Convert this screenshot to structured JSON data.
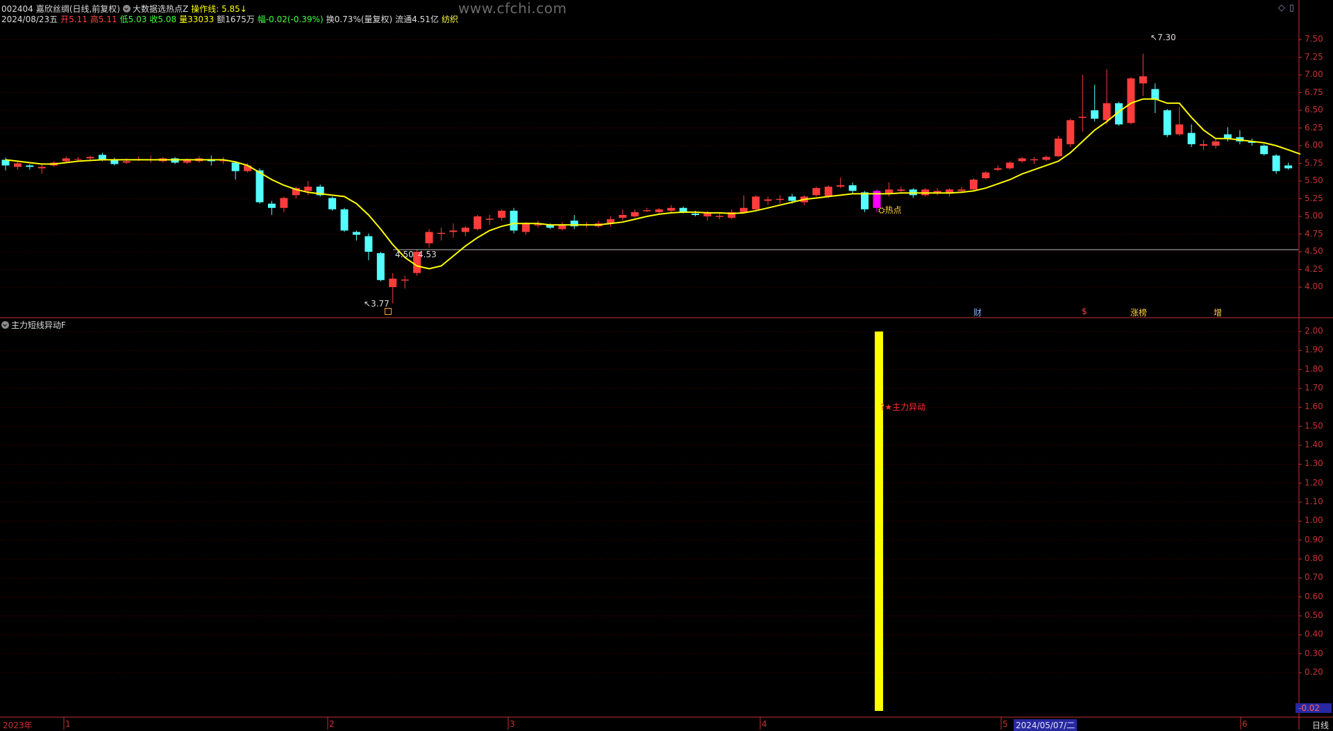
{
  "header": {
    "code": "002404",
    "name": "嘉欣丝绸(日线,前复权)",
    "indicator": "大数据选热点Z",
    "op_line": "操作线: 5.85↓",
    "date": "2024/08/23五",
    "open": "开5.11",
    "high": "高5.11",
    "low": "低5.03",
    "close": "收5.08",
    "volume": "量33033",
    "amount": "额1675万",
    "change": "幅-0.02(-0.39%)",
    "turnover": "换0.73%(量复权)",
    "float_cap": "流通4.51亿",
    "industry": "纺织"
  },
  "watermark": "www.cfchi.com",
  "top_icons": [
    "◇",
    "▯"
  ],
  "upper": {
    "y_labels": [
      "7.50",
      "7.25",
      "7.00",
      "6.75",
      "6.50",
      "6.25",
      "6.00",
      "5.75",
      "5.50",
      "5.25",
      "5.00",
      "4.75",
      "4.50",
      "4.25",
      "4.00"
    ],
    "annotations": {
      "high_mark": "7.30",
      "low_mark": "3.77",
      "h_line_left": "4.50",
      "h_line_right": "4.53",
      "hot_label": "热点"
    },
    "events": [
      "财",
      "$",
      "涨榜",
      "增"
    ]
  },
  "lower": {
    "title": "主力短线异动F",
    "y_labels": [
      "2.00",
      "1.90",
      "1.80",
      "1.70",
      "1.60",
      "1.50",
      "1.40",
      "1.30",
      "1.20",
      "1.10",
      "1.00",
      "0.90",
      "0.80",
      "0.70",
      "0.60",
      "0.50",
      "0.40",
      "0.30",
      "0.20"
    ],
    "signal_label": "★主力异动",
    "current_value": "-0.02"
  },
  "bottom": {
    "year_label": "2023年",
    "month_labels": [
      "1",
      "2",
      "3",
      "4",
      "5",
      "6"
    ],
    "cursor_date": "2024/05/07/二",
    "period": "日线"
  },
  "colors": {
    "up": "#ff3c3c",
    "down": "#54ffff",
    "ma": "#ffff00",
    "grid": "#5a0000",
    "axis": "#c83232",
    "signal": "#ffff00",
    "highlight": "#ff00ff"
  },
  "chart_data": {
    "type": "candlestick",
    "ylim": [
      3.8,
      7.55
    ],
    "candles": [
      {
        "o": 5.8,
        "c": 5.72,
        "h": 5.83,
        "l": 5.65
      },
      {
        "o": 5.7,
        "c": 5.75,
        "h": 5.78,
        "l": 5.66
      },
      {
        "o": 5.72,
        "c": 5.7,
        "h": 5.74,
        "l": 5.66
      },
      {
        "o": 5.68,
        "c": 5.7,
        "h": 5.74,
        "l": 5.6
      },
      {
        "o": 5.72,
        "c": 5.76,
        "h": 5.78,
        "l": 5.7
      },
      {
        "o": 5.78,
        "c": 5.82,
        "h": 5.85,
        "l": 5.76
      },
      {
        "o": 5.8,
        "c": 5.81,
        "h": 5.84,
        "l": 5.77
      },
      {
        "o": 5.82,
        "c": 5.84,
        "h": 5.86,
        "l": 5.8
      },
      {
        "o": 5.87,
        "c": 5.8,
        "h": 5.9,
        "l": 5.78
      },
      {
        "o": 5.8,
        "c": 5.74,
        "h": 5.83,
        "l": 5.72
      },
      {
        "o": 5.76,
        "c": 5.78,
        "h": 5.82,
        "l": 5.74
      },
      {
        "o": 5.8,
        "c": 5.81,
        "h": 5.85,
        "l": 5.78
      },
      {
        "o": 5.8,
        "c": 5.8,
        "h": 5.86,
        "l": 5.76
      },
      {
        "o": 5.78,
        "c": 5.82,
        "h": 5.84,
        "l": 5.76
      },
      {
        "o": 5.82,
        "c": 5.76,
        "h": 5.84,
        "l": 5.74
      },
      {
        "o": 5.76,
        "c": 5.8,
        "h": 5.82,
        "l": 5.74
      },
      {
        "o": 5.78,
        "c": 5.82,
        "h": 5.85,
        "l": 5.76
      },
      {
        "o": 5.8,
        "c": 5.78,
        "h": 5.86,
        "l": 5.72
      },
      {
        "o": 5.78,
        "c": 5.79,
        "h": 5.84,
        "l": 5.74
      },
      {
        "o": 5.76,
        "c": 5.64,
        "h": 5.78,
        "l": 5.52
      },
      {
        "o": 5.64,
        "c": 5.72,
        "h": 5.75,
        "l": 5.62
      },
      {
        "o": 5.65,
        "c": 5.2,
        "h": 5.68,
        "l": 5.18
      },
      {
        "o": 5.18,
        "c": 5.12,
        "h": 5.22,
        "l": 5.02
      },
      {
        "o": 5.12,
        "c": 5.26,
        "h": 5.28,
        "l": 5.06
      },
      {
        "o": 5.3,
        "c": 5.4,
        "h": 5.42,
        "l": 5.25
      },
      {
        "o": 5.36,
        "c": 5.42,
        "h": 5.5,
        "l": 5.3
      },
      {
        "o": 5.42,
        "c": 5.3,
        "h": 5.45,
        "l": 5.28
      },
      {
        "o": 5.26,
        "c": 5.1,
        "h": 5.28,
        "l": 5.08
      },
      {
        "o": 5.1,
        "c": 4.8,
        "h": 5.12,
        "l": 4.78
      },
      {
        "o": 4.78,
        "c": 4.74,
        "h": 4.8,
        "l": 4.66
      },
      {
        "o": 4.72,
        "c": 4.5,
        "h": 4.76,
        "l": 4.38
      },
      {
        "o": 4.48,
        "c": 4.1,
        "h": 4.5,
        "l": 4.08
      },
      {
        "o": 4.0,
        "c": 4.12,
        "h": 4.2,
        "l": 3.77
      },
      {
        "o": 4.1,
        "c": 4.1,
        "h": 4.16,
        "l": 3.98
      },
      {
        "o": 4.2,
        "c": 4.5,
        "h": 4.53,
        "l": 4.16
      },
      {
        "o": 4.62,
        "c": 4.78,
        "h": 4.82,
        "l": 4.56
      },
      {
        "o": 4.76,
        "c": 4.76,
        "h": 4.84,
        "l": 4.66
      },
      {
        "o": 4.78,
        "c": 4.8,
        "h": 4.9,
        "l": 4.7
      },
      {
        "o": 4.78,
        "c": 4.84,
        "h": 4.86,
        "l": 4.72
      },
      {
        "o": 4.82,
        "c": 5.0,
        "h": 5.02,
        "l": 4.8
      },
      {
        "o": 4.96,
        "c": 4.96,
        "h": 5.02,
        "l": 4.88
      },
      {
        "o": 4.98,
        "c": 5.08,
        "h": 5.1,
        "l": 4.94
      },
      {
        "o": 5.08,
        "c": 4.8,
        "h": 5.12,
        "l": 4.76
      },
      {
        "o": 4.78,
        "c": 4.9,
        "h": 4.92,
        "l": 4.74
      },
      {
        "o": 4.88,
        "c": 4.88,
        "h": 4.94,
        "l": 4.84
      },
      {
        "o": 4.88,
        "c": 4.84,
        "h": 4.9,
        "l": 4.82
      },
      {
        "o": 4.82,
        "c": 4.88,
        "h": 4.92,
        "l": 4.8
      },
      {
        "o": 4.94,
        "c": 4.86,
        "h": 5.02,
        "l": 4.82
      },
      {
        "o": 4.88,
        "c": 4.88,
        "h": 4.92,
        "l": 4.84
      },
      {
        "o": 4.86,
        "c": 4.9,
        "h": 4.94,
        "l": 4.84
      },
      {
        "o": 4.9,
        "c": 4.96,
        "h": 5.0,
        "l": 4.86
      },
      {
        "o": 4.98,
        "c": 5.02,
        "h": 5.1,
        "l": 4.94
      },
      {
        "o": 5.0,
        "c": 5.06,
        "h": 5.1,
        "l": 4.98
      },
      {
        "o": 5.08,
        "c": 5.08,
        "h": 5.12,
        "l": 5.06
      },
      {
        "o": 5.06,
        "c": 5.1,
        "h": 5.12,
        "l": 5.04
      },
      {
        "o": 5.08,
        "c": 5.12,
        "h": 5.16,
        "l": 5.06
      },
      {
        "o": 5.12,
        "c": 5.06,
        "h": 5.14,
        "l": 5.04
      },
      {
        "o": 5.04,
        "c": 5.02,
        "h": 5.08,
        "l": 5.0
      },
      {
        "o": 5.0,
        "c": 5.06,
        "h": 5.08,
        "l": 4.94
      },
      {
        "o": 5.0,
        "c": 5.0,
        "h": 5.04,
        "l": 4.96
      },
      {
        "o": 4.98,
        "c": 5.06,
        "h": 5.1,
        "l": 4.96
      },
      {
        "o": 5.06,
        "c": 5.12,
        "h": 5.3,
        "l": 5.04
      },
      {
        "o": 5.1,
        "c": 5.28,
        "h": 5.3,
        "l": 5.08
      },
      {
        "o": 5.22,
        "c": 5.24,
        "h": 5.28,
        "l": 5.16
      },
      {
        "o": 5.24,
        "c": 5.24,
        "h": 5.3,
        "l": 5.18
      },
      {
        "o": 5.28,
        "c": 5.22,
        "h": 5.32,
        "l": 5.18
      },
      {
        "o": 5.2,
        "c": 5.28,
        "h": 5.3,
        "l": 5.16
      },
      {
        "o": 5.3,
        "c": 5.4,
        "h": 5.42,
        "l": 5.28
      },
      {
        "o": 5.28,
        "c": 5.42,
        "h": 5.44,
        "l": 5.26
      },
      {
        "o": 5.42,
        "c": 5.44,
        "h": 5.55,
        "l": 5.4
      },
      {
        "o": 5.44,
        "c": 5.36,
        "h": 5.48,
        "l": 5.32
      },
      {
        "o": 5.34,
        "c": 5.1,
        "h": 5.36,
        "l": 5.06
      },
      {
        "o": 5.12,
        "c": 5.36,
        "h": 5.38,
        "l": 5.06,
        "hl": true
      },
      {
        "o": 5.32,
        "c": 5.38,
        "h": 5.48,
        "l": 5.28
      },
      {
        "o": 5.36,
        "c": 5.38,
        "h": 5.42,
        "l": 5.32
      },
      {
        "o": 5.38,
        "c": 5.3,
        "h": 5.4,
        "l": 5.26
      },
      {
        "o": 5.3,
        "c": 5.38,
        "h": 5.4,
        "l": 5.28
      },
      {
        "o": 5.34,
        "c": 5.36,
        "h": 5.4,
        "l": 5.3
      },
      {
        "o": 5.32,
        "c": 5.38,
        "h": 5.4,
        "l": 5.28
      },
      {
        "o": 5.36,
        "c": 5.38,
        "h": 5.42,
        "l": 5.34
      },
      {
        "o": 5.38,
        "c": 5.52,
        "h": 5.54,
        "l": 5.36
      },
      {
        "o": 5.54,
        "c": 5.62,
        "h": 5.64,
        "l": 5.52
      },
      {
        "o": 5.66,
        "c": 5.68,
        "h": 5.72,
        "l": 5.64
      },
      {
        "o": 5.68,
        "c": 5.76,
        "h": 5.78,
        "l": 5.66
      },
      {
        "o": 5.78,
        "c": 5.82,
        "h": 5.84,
        "l": 5.76
      },
      {
        "o": 5.8,
        "c": 5.8,
        "h": 5.84,
        "l": 5.74
      },
      {
        "o": 5.8,
        "c": 5.84,
        "h": 5.86,
        "l": 5.78
      },
      {
        "o": 5.85,
        "c": 6.1,
        "h": 6.14,
        "l": 5.84
      },
      {
        "o": 6.02,
        "c": 6.36,
        "h": 6.38,
        "l": 5.98
      },
      {
        "o": 6.4,
        "c": 6.4,
        "h": 7.0,
        "l": 6.2
      },
      {
        "o": 6.5,
        "c": 6.38,
        "h": 6.86,
        "l": 6.34
      },
      {
        "o": 6.36,
        "c": 6.6,
        "h": 7.08,
        "l": 6.3
      },
      {
        "o": 6.6,
        "c": 6.3,
        "h": 6.62,
        "l": 6.28
      },
      {
        "o": 6.32,
        "c": 6.95,
        "h": 6.97,
        "l": 6.3
      },
      {
        "o": 6.88,
        "c": 6.98,
        "h": 7.3,
        "l": 6.7
      },
      {
        "o": 6.8,
        "c": 6.65,
        "h": 6.88,
        "l": 6.46
      },
      {
        "o": 6.5,
        "c": 6.15,
        "h": 6.52,
        "l": 6.12
      },
      {
        "o": 6.16,
        "c": 6.3,
        "h": 6.55,
        "l": 6.14
      },
      {
        "o": 6.18,
        "c": 6.02,
        "h": 6.3,
        "l": 5.98
      },
      {
        "o": 6.0,
        "c": 6.02,
        "h": 6.08,
        "l": 5.94
      },
      {
        "o": 6.0,
        "c": 6.06,
        "h": 6.1,
        "l": 5.96
      },
      {
        "o": 6.16,
        "c": 6.1,
        "h": 6.26,
        "l": 6.06
      },
      {
        "o": 6.12,
        "c": 6.06,
        "h": 6.22,
        "l": 6.02
      },
      {
        "o": 6.06,
        "c": 6.04,
        "h": 6.1,
        "l": 6.0
      },
      {
        "o": 6.0,
        "c": 5.88,
        "h": 6.02,
        "l": 5.86
      },
      {
        "o": 5.86,
        "c": 5.64,
        "h": 5.88,
        "l": 5.6
      },
      {
        "o": 5.72,
        "c": 5.68,
        "h": 5.76,
        "l": 5.66
      }
    ],
    "ma": [
      5.8,
      5.78,
      5.76,
      5.74,
      5.74,
      5.76,
      5.78,
      5.79,
      5.8,
      5.8,
      5.8,
      5.8,
      5.8,
      5.8,
      5.8,
      5.8,
      5.8,
      5.8,
      5.8,
      5.77,
      5.72,
      5.62,
      5.52,
      5.44,
      5.38,
      5.34,
      5.32,
      5.3,
      5.28,
      5.18,
      5.02,
      4.82,
      4.6,
      4.42,
      4.3,
      4.26,
      4.3,
      4.44,
      4.58,
      4.7,
      4.8,
      4.86,
      4.9,
      4.9,
      4.9,
      4.88,
      4.88,
      4.88,
      4.88,
      4.88,
      4.9,
      4.92,
      4.96,
      5.0,
      5.03,
      5.05,
      5.06,
      5.06,
      5.05,
      5.05,
      5.04,
      5.05,
      5.08,
      5.12,
      5.16,
      5.2,
      5.24,
      5.26,
      5.28,
      5.3,
      5.32,
      5.32,
      5.32,
      5.32,
      5.33,
      5.33,
      5.33,
      5.33,
      5.33,
      5.34,
      5.36,
      5.4,
      5.46,
      5.52,
      5.6,
      5.66,
      5.72,
      5.78,
      5.9,
      6.06,
      6.22,
      6.34,
      6.48,
      6.6,
      6.66,
      6.66,
      6.6,
      6.6,
      6.4,
      6.22,
      6.1,
      6.1,
      6.08,
      6.06,
      6.04,
      6.0,
      5.94,
      5.88
    ],
    "ma_start": 0,
    "h_line": 4.53,
    "signal_bar": {
      "value": 2.0,
      "index": 72
    }
  }
}
